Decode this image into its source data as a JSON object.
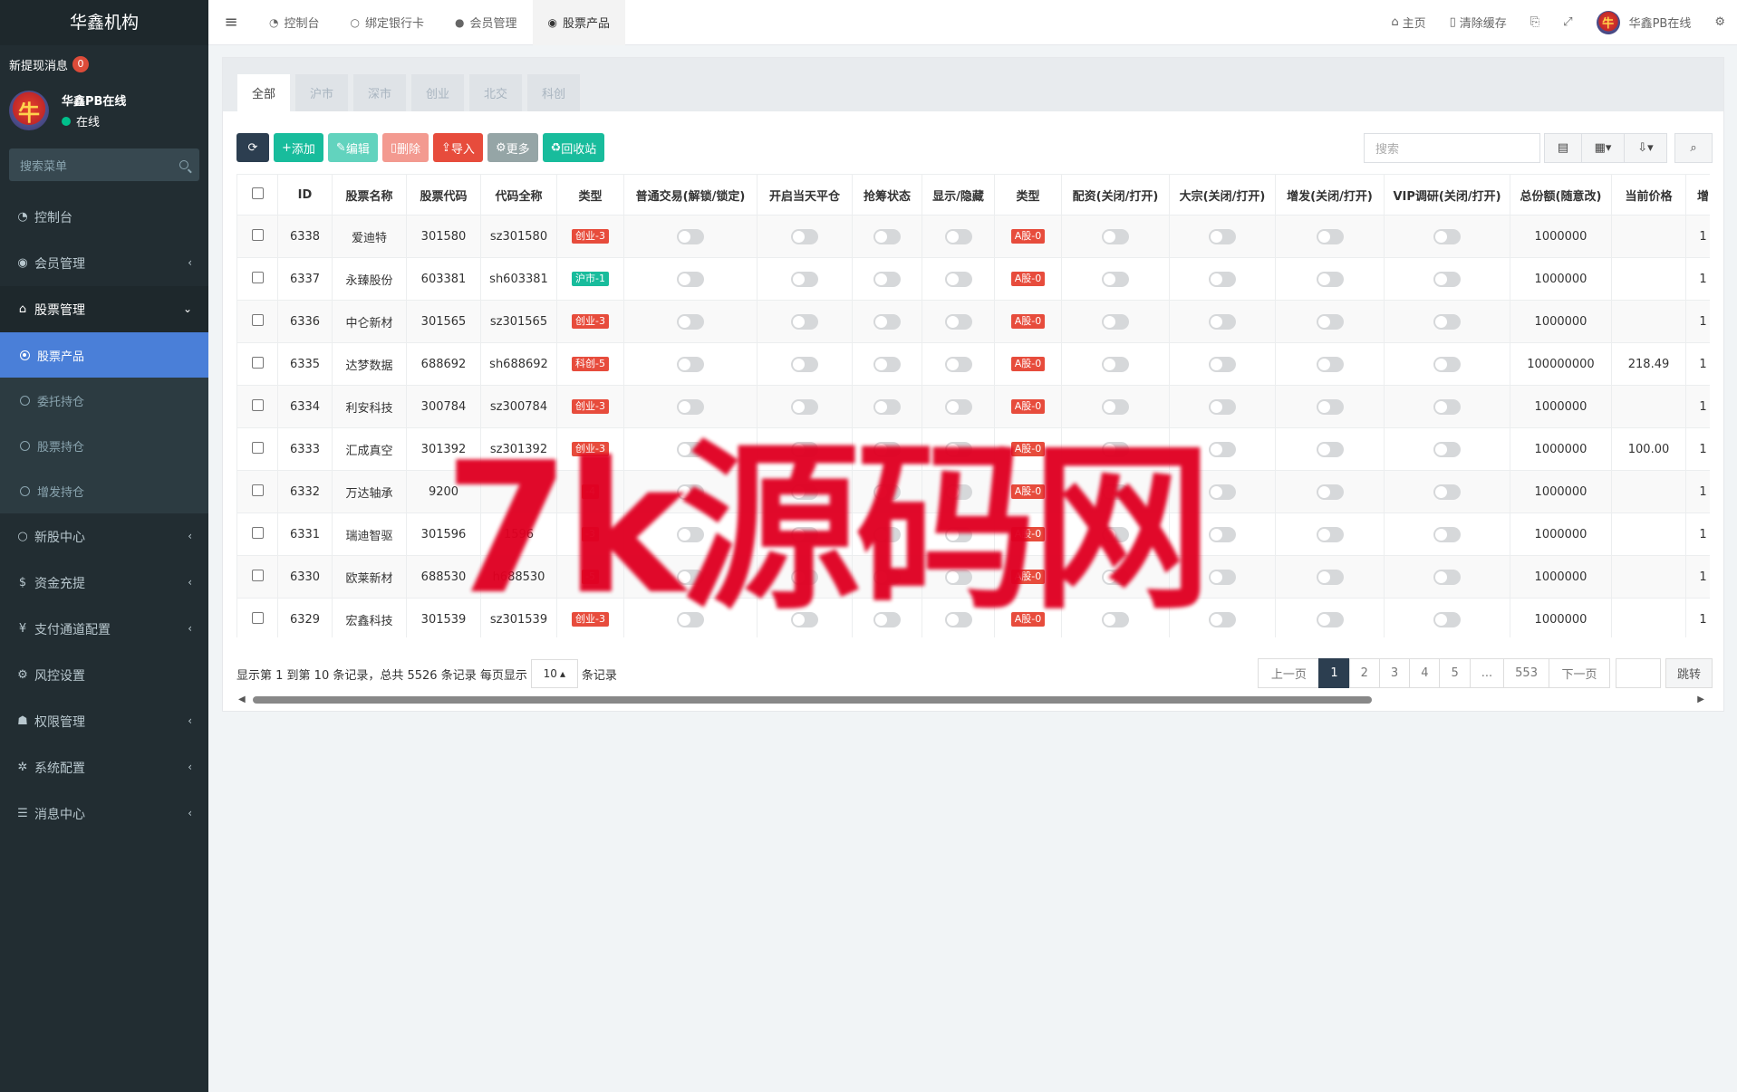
{
  "brand": "华鑫机构",
  "notice": {
    "label": "新提现消息",
    "count": "0"
  },
  "user": {
    "name": "华鑫PB在线",
    "status": "在线",
    "avatar_text": "牛"
  },
  "menu_search": {
    "placeholder": "搜索菜单"
  },
  "menu": [
    {
      "label": "控制台",
      "icon": "dashboard-icon"
    },
    {
      "label": "会员管理",
      "icon": "user-circle-icon"
    },
    {
      "label": "股票管理",
      "icon": "bank-icon"
    },
    {
      "label": "新股中心",
      "icon": "circle-icon"
    },
    {
      "label": "资金充提",
      "icon": "dollar-icon"
    },
    {
      "label": "支付通道配置",
      "icon": "yen-icon"
    },
    {
      "label": "风控设置",
      "icon": "gear-icon"
    },
    {
      "label": "权限管理",
      "icon": "users-icon"
    },
    {
      "label": "系统配置",
      "icon": "cog-icon"
    },
    {
      "label": "消息中心",
      "icon": "list-icon"
    }
  ],
  "submenu": [
    {
      "label": "股票产品",
      "active": true
    },
    {
      "label": "委托持仓"
    },
    {
      "label": "股票持仓"
    },
    {
      "label": "增发持仓"
    }
  ],
  "top_tabs": [
    {
      "label": "控制台"
    },
    {
      "label": "绑定银行卡"
    },
    {
      "label": "会员管理"
    },
    {
      "label": "股票产品",
      "active": true
    }
  ],
  "top_right": {
    "home": "主页",
    "clear_cache": "清除缓存",
    "user": "华鑫PB在线"
  },
  "filter_tabs": [
    "全部",
    "沪市",
    "深市",
    "创业",
    "北交",
    "科创"
  ],
  "toolbar": {
    "add": "添加",
    "edit": "编辑",
    "delete": "删除",
    "import": "导入",
    "more": "更多",
    "recycle": "回收站"
  },
  "table_search": {
    "placeholder": "搜索"
  },
  "table": {
    "columns": [
      "ID",
      "股票名称",
      "股票代码",
      "代码全称",
      "类型",
      "普通交易(解锁/锁定)",
      "开启当天平仓",
      "抢筹状态",
      "显示/隐藏",
      "类型",
      "配资(关闭/打开)",
      "大宗(关闭/打开)",
      "增发(关闭/打开)",
      "VIP调研(关闭/打开)",
      "总份额(随意改)",
      "当前价格",
      "增"
    ],
    "rows": [
      {
        "id": "6338",
        "name": "爱迪特",
        "code": "301580",
        "full": "sz301580",
        "type": "创业-3",
        "type_color": "red",
        "type2": "A股-0",
        "total": "1000000",
        "price": "",
        "extra": "1"
      },
      {
        "id": "6337",
        "name": "永臻股份",
        "code": "603381",
        "full": "sh603381",
        "type": "沪市-1",
        "type_color": "green",
        "type2": "A股-0",
        "total": "1000000",
        "price": "",
        "extra": "1"
      },
      {
        "id": "6336",
        "name": "中仑新材",
        "code": "301565",
        "full": "sz301565",
        "type": "创业-3",
        "type_color": "red",
        "type2": "A股-0",
        "total": "1000000",
        "price": "",
        "extra": "1"
      },
      {
        "id": "6335",
        "name": "达梦数据",
        "code": "688692",
        "full": "sh688692",
        "type": "科创-5",
        "type_color": "red",
        "type2": "A股-0",
        "total": "100000000",
        "price": "218.49",
        "extra": "1"
      },
      {
        "id": "6334",
        "name": "利安科技",
        "code": "300784",
        "full": "sz300784",
        "type": "创业-3",
        "type_color": "red",
        "type2": "A股-0",
        "total": "1000000",
        "price": "",
        "extra": "1"
      },
      {
        "id": "6333",
        "name": "汇成真空",
        "code": "301392",
        "full": "sz301392",
        "type": "创业-3",
        "type_color": "red",
        "type2": "A股-0",
        "total": "1000000",
        "price": "100.00",
        "extra": "1"
      },
      {
        "id": "6332",
        "name": "万达轴承",
        "code": "9200",
        "full": "",
        "type": "-4",
        "type_color": "red",
        "type2": "A股-0",
        "total": "1000000",
        "price": "",
        "extra": "1"
      },
      {
        "id": "6331",
        "name": "瑞迪智驱",
        "code": "301596",
        "full": "1596",
        "type": "-3",
        "type_color": "red",
        "type2": "A股-0",
        "total": "1000000",
        "price": "",
        "extra": "1"
      },
      {
        "id": "6330",
        "name": "欧莱新材",
        "code": "688530",
        "full": "h688530",
        "type": "-5",
        "type_color": "red",
        "type2": "A股-0",
        "total": "1000000",
        "price": "",
        "extra": "1"
      },
      {
        "id": "6329",
        "name": "宏鑫科技",
        "code": "301539",
        "full": "sz301539",
        "type": "创业-3",
        "type_color": "red",
        "type2": "A股-0",
        "total": "1000000",
        "price": "",
        "extra": "1"
      }
    ]
  },
  "footer": {
    "info": "显示第 1 到第 10 条记录，总共 5526 条记录 每页显示",
    "page_size": "10",
    "suffix": "条记录"
  },
  "pagination": {
    "prev": "上一页",
    "pages": [
      "1",
      "2",
      "3",
      "4",
      "5",
      "...",
      "553"
    ],
    "next": "下一页",
    "goto": "跳转"
  },
  "watermark": "7k源码网"
}
